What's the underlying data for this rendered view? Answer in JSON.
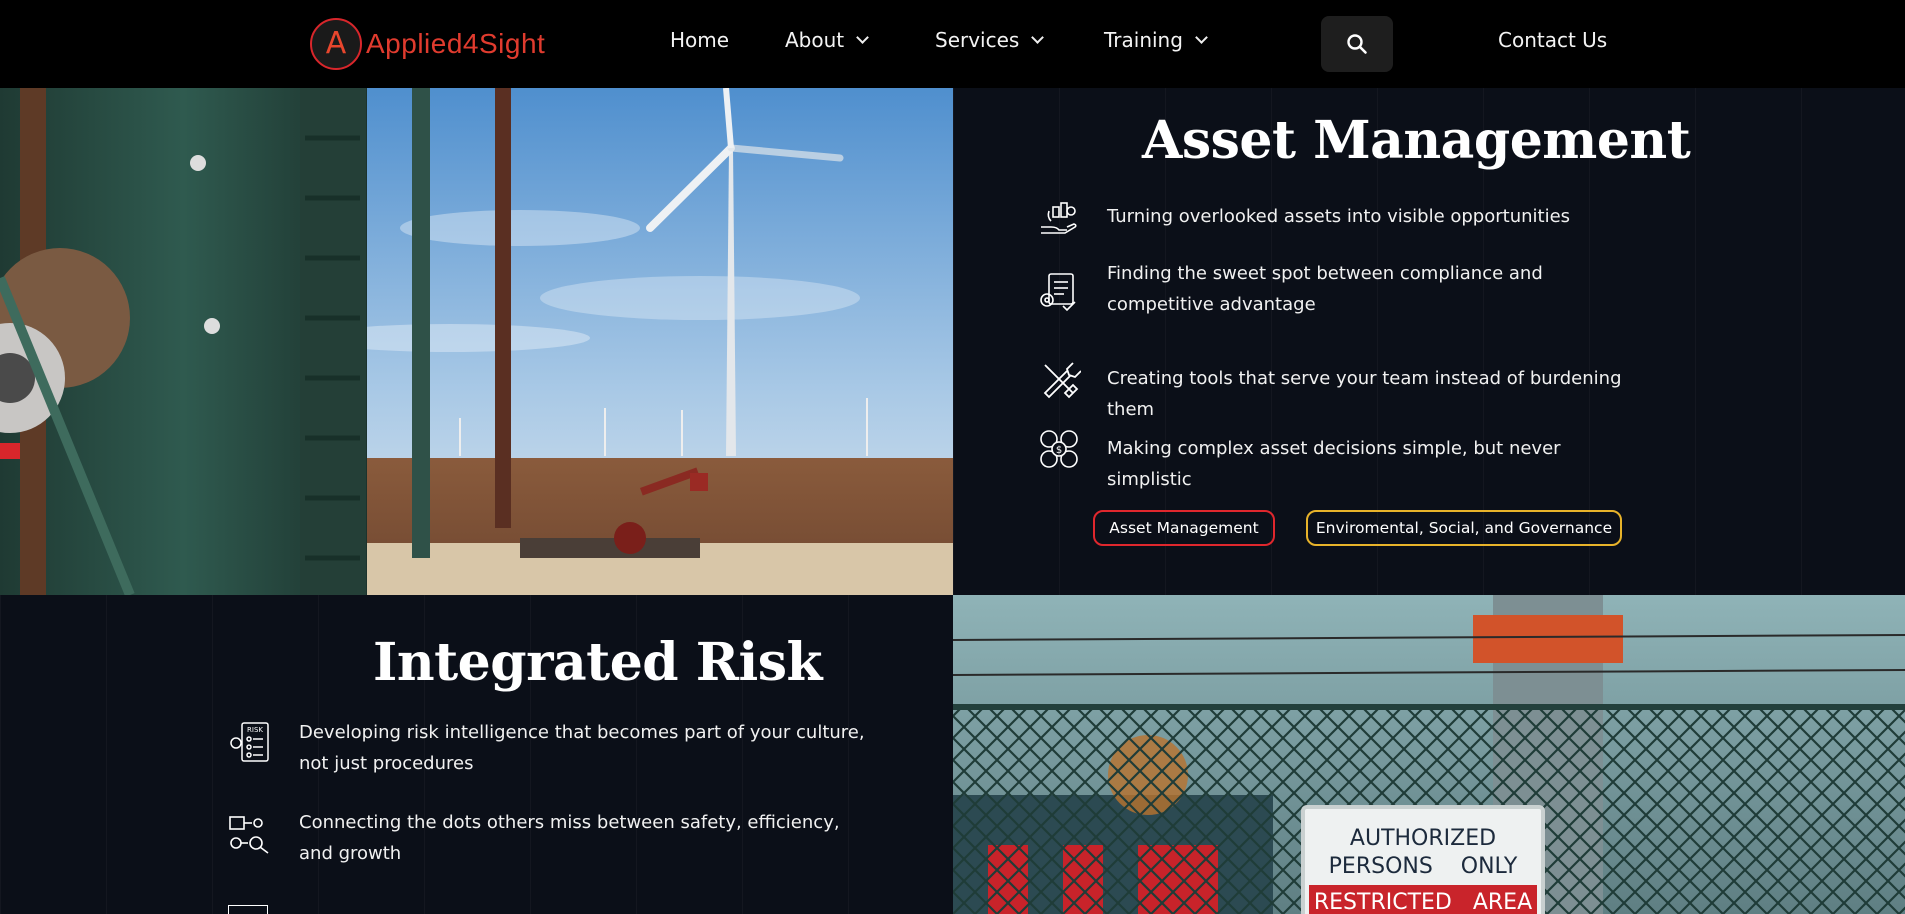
{
  "brand": {
    "logo_letter": "A",
    "name": "Applied4Sight",
    "color": "#e03b2e"
  },
  "nav": {
    "home": "Home",
    "about": "About",
    "services": "Services",
    "training": "Training",
    "contact": "Contact Us",
    "search_icon": "search-icon"
  },
  "asset": {
    "title": "Asset Management",
    "items": [
      {
        "icon": "hand-assets-icon",
        "text": "Turning overlooked assets into visible opportunities"
      },
      {
        "icon": "compliance-document-icon",
        "text": "Finding the sweet spot between compliance and competitive advantage"
      },
      {
        "icon": "tools-wrench-screwdriver-icon",
        "text": "Creating tools that serve your team instead of burdening them"
      },
      {
        "icon": "decision-money-icon",
        "text": "Making complex asset decisions simple, but never simplistic"
      }
    ],
    "tags": [
      {
        "label": "Asset Management",
        "color": "#e0272d"
      },
      {
        "label": "Enviromental, Social, and Governance",
        "color": "#e8b32a"
      }
    ]
  },
  "risk": {
    "title": "Integrated Risk",
    "items": [
      {
        "icon": "risk-report-icon",
        "text": "Developing risk intelligence that becomes part of your culture, not just procedures"
      },
      {
        "icon": "connected-nodes-icon",
        "text": "Connecting the dots others miss between safety, efficiency, and growth"
      }
    ]
  },
  "images": {
    "windfarm": "industrial-pipes-and-wind-turbine-photo",
    "fence": "restricted-area-fence-photo",
    "sign_line1": "AUTHORIZED",
    "sign_line2": "PERSONS    ONLY",
    "sign_line3": "RESTRICTED   AREA"
  },
  "colors": {
    "background": "#0b0f18",
    "nav": "#000000",
    "accent_red": "#e0272d",
    "accent_yellow": "#e8b32a"
  }
}
